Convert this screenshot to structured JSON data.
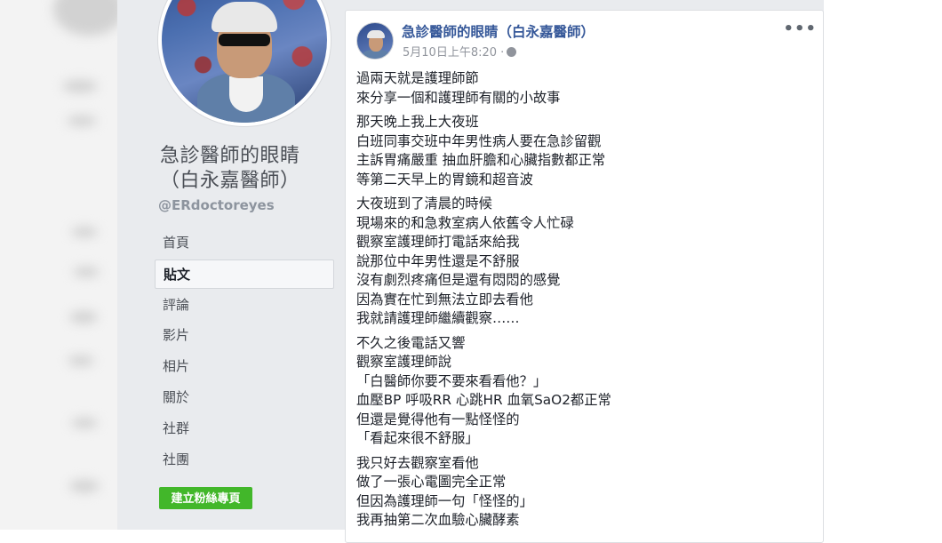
{
  "page": {
    "name_line1": "急診醫師的眼睛",
    "name_line2": "（白永嘉醫師）",
    "handle": "@ERdoctoreyes"
  },
  "nav": {
    "items": [
      {
        "label": "首頁"
      },
      {
        "label": "貼文"
      },
      {
        "label": "評論"
      },
      {
        "label": "影片"
      },
      {
        "label": "相片"
      },
      {
        "label": "關於"
      },
      {
        "label": "社群"
      },
      {
        "label": "社團"
      }
    ],
    "active_index": 1
  },
  "create_button": {
    "label": "建立粉絲專頁"
  },
  "post": {
    "author": "急診醫師的眼睛（白永嘉醫師）",
    "time": "5月10日上午8:20 ·",
    "more": "•••",
    "paragraphs": [
      [
        "過兩天就是護理師節",
        "來分享一個和護理師有關的小故事"
      ],
      [
        "那天晚上我上大夜班",
        "白班同事交班中年男性病人要在急診留觀",
        "主訴胃痛嚴重 抽血肝膽和心臟指數都正常",
        "等第二天早上的胃鏡和超音波"
      ],
      [
        "大夜班到了清晨的時候",
        "現場來的和急救室病人依舊令人忙碌",
        "觀察室護理師打電話來給我",
        "說那位中年男性還是不舒服",
        "沒有劇烈疼痛但是還有悶悶的感覺",
        "因為實在忙到無法立即去看他",
        "我就請護理師繼續觀察……"
      ],
      [
        "不久之後電話又響",
        "觀察室護理師說",
        "「白醫師你要不要來看看他？」",
        "血壓BP 呼吸RR 心跳HR 血氧SaO2都正常",
        "但還是覺得他有一點怪怪的",
        "「看起來很不舒服」"
      ],
      [
        "我只好去觀察室看他",
        "做了一張心電圖完全正常",
        "但因為護理師一句「怪怪的」",
        "我再抽第二次血驗心臟酵素"
      ]
    ]
  },
  "colors": {
    "page_bg": "#e9ebee",
    "link": "#365899",
    "button_green": "#42b72a"
  },
  "icons": [
    "avatar",
    "globe-icon",
    "more-icon"
  ]
}
